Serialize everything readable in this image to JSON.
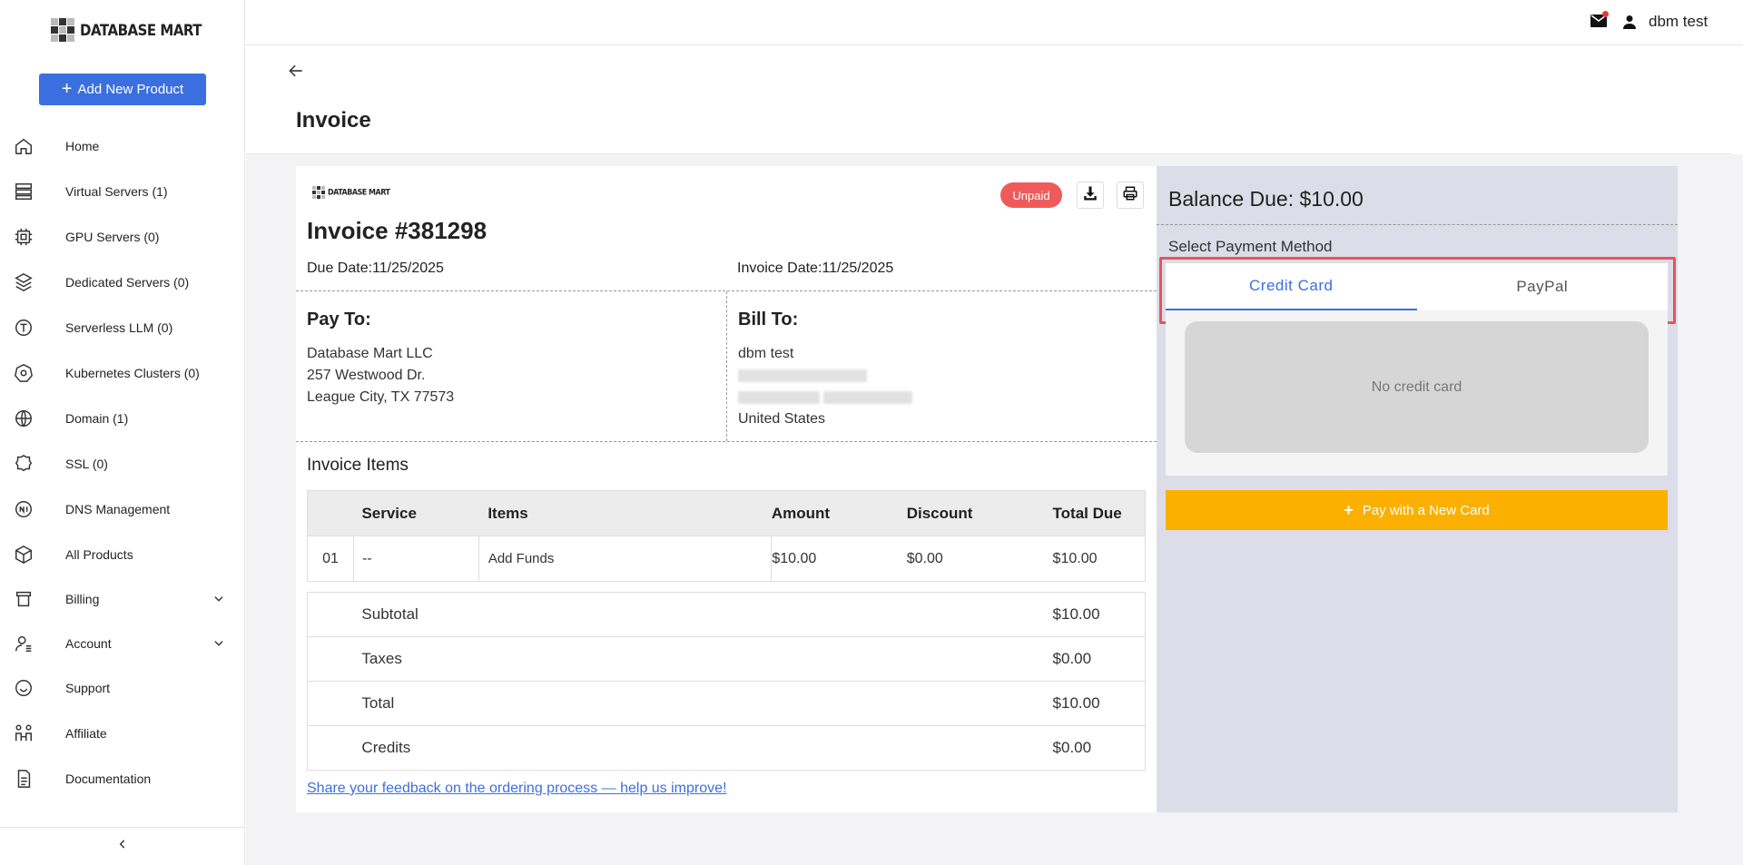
{
  "brand": {
    "name": "DATABASE MART"
  },
  "sidebar": {
    "add_button": "Add New Product",
    "items": [
      {
        "label": "Home",
        "icon": "home-icon"
      },
      {
        "label": "Virtual Servers (1)",
        "icon": "server-icon"
      },
      {
        "label": "GPU Servers (0)",
        "icon": "chip-icon"
      },
      {
        "label": "Dedicated Servers (0)",
        "icon": "cube-stack-icon"
      },
      {
        "label": "Serverless LLM (0)",
        "icon": "llm-icon"
      },
      {
        "label": "Kubernetes Clusters (0)",
        "icon": "kubernetes-icon"
      },
      {
        "label": "Domain (1)",
        "icon": "globe-icon"
      },
      {
        "label": "SSL (0)",
        "icon": "ssl-badge-icon"
      },
      {
        "label": "DNS Management",
        "icon": "dns-icon"
      },
      {
        "label": "All Products",
        "icon": "box-icon"
      },
      {
        "label": "Billing",
        "icon": "billing-icon"
      },
      {
        "label": "Account",
        "icon": "account-icon"
      },
      {
        "label": "Support",
        "icon": "support-icon"
      },
      {
        "label": "Affiliate",
        "icon": "affiliate-icon"
      },
      {
        "label": "Documentation",
        "icon": "document-icon"
      }
    ]
  },
  "topbar": {
    "user_name": "dbm test"
  },
  "page": {
    "title": "Invoice"
  },
  "invoice": {
    "status": "Unpaid",
    "number": "Invoice #381298",
    "due_date": "Due Date:11/25/2025",
    "invoice_date": "Invoice Date:11/25/2025",
    "pay_to": {
      "heading": "Pay To:",
      "line1": "Database Mart LLC",
      "line2": "257 Westwood Dr.",
      "line3": "League City, TX 77573"
    },
    "bill_to": {
      "heading": "Bill To:",
      "name": "dbm test",
      "country": "United States"
    },
    "items_title": "Invoice Items",
    "columns": [
      "Service",
      "Items",
      "Amount",
      "Discount",
      "Total Due"
    ],
    "rows": [
      {
        "no": "01",
        "service": "--",
        "item": "Add Funds",
        "amount": "$10.00",
        "discount": "$0.00",
        "total": "$10.00"
      }
    ],
    "summary": [
      {
        "label": "Subtotal",
        "value": "$10.00"
      },
      {
        "label": "Taxes",
        "value": "$0.00"
      },
      {
        "label": "Total",
        "value": "$10.00"
      },
      {
        "label": "Credits",
        "value": "$0.00"
      }
    ],
    "feedback_link": "Share your feedback on the ordering process — help us improve!"
  },
  "payment": {
    "balance": "Balance Due: $10.00",
    "method_label": "Select Payment Method",
    "tabs": [
      "Credit Card",
      "PayPal"
    ],
    "active_tab": "Credit Card",
    "no_card": "No credit card",
    "pay_new": "Pay with a New Card"
  },
  "colors": {
    "primary": "#3b6fe0",
    "unpaid": "#ef5b5b",
    "pay_button": "#fbb000",
    "panel_bg": "#dcdde8",
    "highlight": "#e15759"
  }
}
